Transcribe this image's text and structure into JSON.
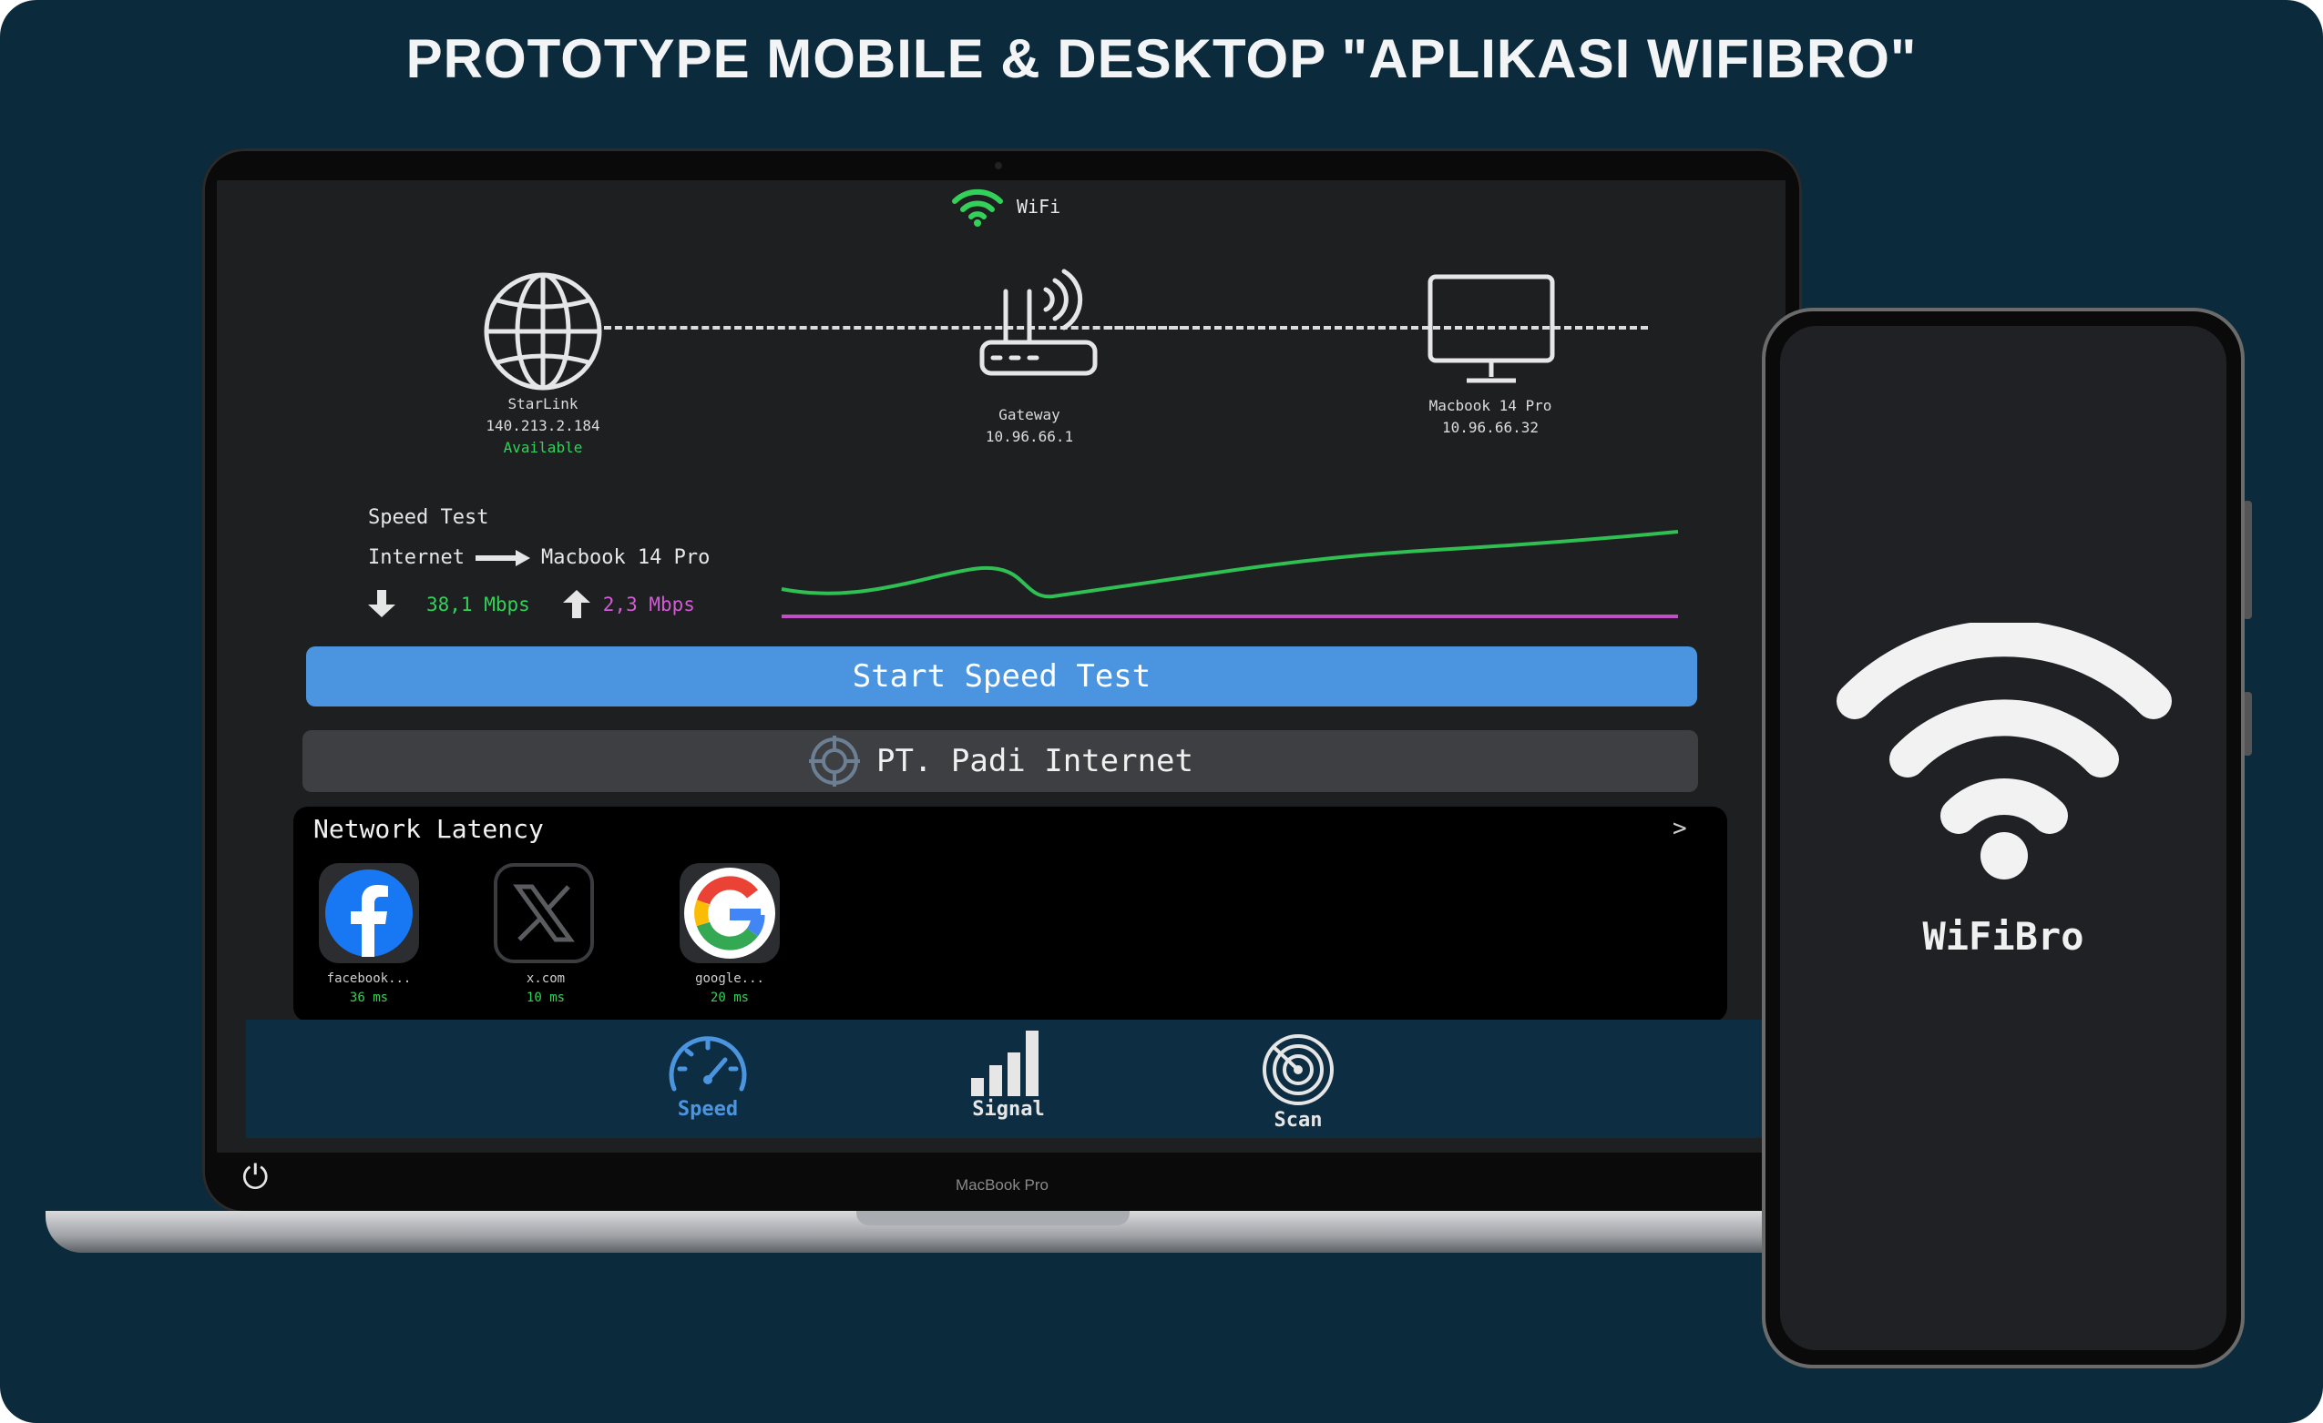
{
  "header": {
    "title": "PROTOTYPE  MOBILE & DESKTOP \"APLIKASI WIFIBRO\""
  },
  "laptop": {
    "model_label": "MacBook Pro",
    "status_bar": {
      "connection_label": "WiFi",
      "icon": "wifi-icon",
      "icon_color": "#33d15a"
    },
    "network_path": {
      "internet": {
        "icon": "globe-icon",
        "name": "StarLink",
        "ip": "140.213.2.184",
        "status": "Available"
      },
      "gateway": {
        "icon": "router-icon",
        "name": "Gateway",
        "ip": "10.96.66.1"
      },
      "device": {
        "icon": "monitor-icon",
        "name": "Macbook 14 Pro",
        "ip": "10.96.66.32"
      }
    },
    "speed_test": {
      "title": "Speed Test",
      "route_from": "Internet",
      "route_to": "Macbook 14 Pro",
      "download": "38,1 Mbps",
      "upload": "2,3 Mbps",
      "download_color": "#33d15a",
      "upload_color": "#d35bd6",
      "start_label": "Start Speed Test"
    },
    "isp": {
      "name": "PT. Padi Internet",
      "icon": "crosshair-icon"
    },
    "latency": {
      "title": "Network Latency",
      "more_icon": ">",
      "sites": [
        {
          "icon": "facebook-icon",
          "name": "facebook...",
          "ms": "36 ms"
        },
        {
          "icon": "x-icon",
          "name": "x.com",
          "ms": "10 ms"
        },
        {
          "icon": "google-icon",
          "name": "google...",
          "ms": "20 ms"
        }
      ]
    },
    "tabs": [
      {
        "label": "Speed",
        "icon": "speedometer-icon",
        "active": true,
        "color": "#4b94df"
      },
      {
        "label": "Signal",
        "icon": "signal-bars-icon",
        "active": false,
        "color": "#e6e6e6"
      },
      {
        "label": "Scan",
        "icon": "radar-icon",
        "active": false,
        "color": "#e6e6e6"
      }
    ]
  },
  "phone": {
    "app_name": "WiFiBro",
    "icon": "wifi-icon"
  }
}
